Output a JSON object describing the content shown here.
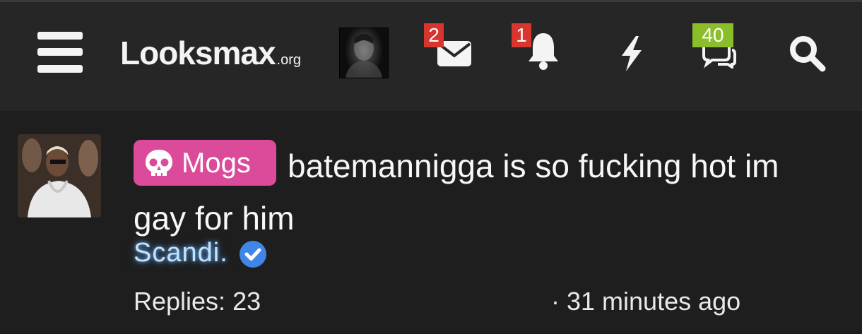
{
  "navbar": {
    "logo_main": "Looksmax",
    "logo_tld": ".org",
    "conversations_count": "2",
    "alerts_count": "1",
    "new_posts_count": "40",
    "icons": [
      "menu-icon",
      "user-avatar",
      "mail-icon",
      "bell-icon",
      "lightning-icon",
      "chat-icon",
      "search-icon"
    ],
    "colors": {
      "bar": "#262626",
      "badge_red": "#d9352f",
      "badge_green": "#8cbe2c"
    }
  },
  "thread": {
    "prefix": "Mogs",
    "prefix_icon": "skull-icon",
    "prefix_color": "#db4b9a",
    "title": "batemannigga is so fucking hot im gay for him",
    "author": "Scandi.",
    "author_badge": "verified-icon",
    "replies": "Replies: 23",
    "time": "· 31 minutes ago"
  }
}
